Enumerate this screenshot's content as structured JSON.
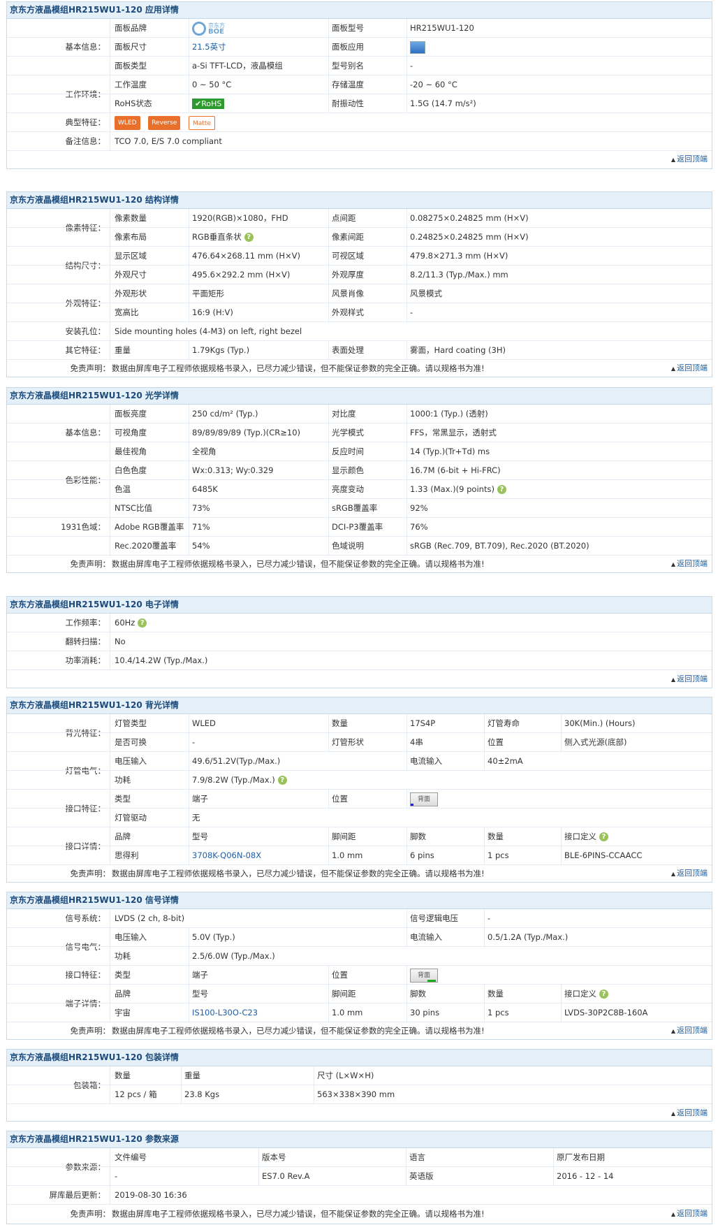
{
  "s1": {
    "title": "京东方液晶模组HR215WU1-120 应用详情",
    "g_basic": "基本信息：",
    "g_env": "工作环境：",
    "g_typ": "典型特征：",
    "g_note": "备注信息：",
    "brand_l": "面板品牌",
    "brand_logo": "京东方 BOE",
    "brand_logo_cn": "京东方",
    "brand_logo_en": "BOE",
    "model_l": "面板型号",
    "model_v": "HR215WU1-120",
    "size_l": "面板尺寸",
    "size_v": "21.5英寸",
    "app_l": "面板应用",
    "app_icon": "monitor-icon",
    "type_l": "面板类型",
    "type_v": "a-Si TFT-LCD，液晶模组",
    "alias_l": "型号别名",
    "alias_v": "-",
    "optemp_l": "工作温度",
    "optemp_v": "0 ~ 50 °C",
    "sttemp_l": "存储温度",
    "sttemp_v": "-20 ~ 60 °C",
    "rohs_l": "RoHS状态",
    "rohs_v": "RoHS",
    "vib_l": "耐振动性",
    "vib_v": "1.5G (14.7 m/s²)",
    "feat1": "WLED",
    "feat2": "Reverse",
    "feat3": "Matte",
    "note_v": "TCO 7.0, E/S 7.0 compliant",
    "top": "返回顶端"
  },
  "s2": {
    "title": "京东方液晶模组HR215WU1-120 结构详情",
    "g_pix": "像素特征：",
    "g_dim": "结构尺寸：",
    "g_look": "外观特征：",
    "g_mount": "安装孔位：",
    "g_other": "其它特征：",
    "px_l": "像素数量",
    "px_v": "1920(RGB)×1080，FHD",
    "dot_l": "点间距",
    "dot_v": "0.08275×0.24825 mm (H×V)",
    "arr_l": "像素布局",
    "arr_v": "RGB垂直条状",
    "pitch_l": "像素间距",
    "pitch_v": "0.24825×0.24825 mm (H×V)",
    "aa_l": "显示区域",
    "aa_v": "476.64×268.11 mm (H×V)",
    "va_l": "可视区域",
    "va_v": "479.8×271.3 mm (H×V)",
    "od_l": "外观尺寸",
    "od_v": "495.6×292.2 mm (H×V)",
    "th_l": "外观厚度",
    "th_v": "8.2/11.3 (Typ./Max.) mm",
    "shape_l": "外观形状",
    "shape_v": "平面矩形",
    "orient_l": "风景肖像",
    "orient_v": "风景模式",
    "ratio_l": "宽高比",
    "ratio_v": "16:9 (H:V)",
    "style_l": "外观样式",
    "style_v": "-",
    "mount_v": "Side mounting holes (4-M3) on left, right bezel",
    "wt_l": "重量",
    "wt_v": "1.79Kgs (Typ.)",
    "surf_l": "表面处理",
    "surf_v": "雾面，Hard coating (3H)",
    "disc_l": "免责声明：",
    "disc_v": "数据由屏库电子工程师依据规格书录入，已尽力减少错误，但不能保证参数的完全正确。请以规格书为准!",
    "top": "返回顶端"
  },
  "s3": {
    "title": "京东方液晶模组HR215WU1-120 光学详情",
    "g_basic": "基本信息：",
    "g_color": "色彩性能：",
    "g_gamut": "1931色域：",
    "br_l": "面板亮度",
    "br_v": "250 cd/m² (Typ.)",
    "cr_l": "对比度",
    "cr_v": "1000:1 (Typ.) (透射)",
    "va_l": "可视角度",
    "va_v": "89/89/89/89 (Typ.)(CR≥10)",
    "mode_l": "光学模式",
    "mode_v": "FFS，常黑显示，透射式",
    "bv_l": "最佳视角",
    "bv_v": "全视角",
    "rt_l": "反应时间",
    "rt_v": "14 (Typ.)(Tr+Td) ms",
    "wc_l": "白色色度",
    "wc_v": "Wx:0.313; Wy:0.329",
    "col_l": "显示颜色",
    "col_v": "16.7M (6-bit + Hi-FRC)",
    "ct_l": "色温",
    "ct_v": "6485K",
    "bvar_l": "亮度变动",
    "bvar_v": "1.33 (Max.)(9 points)",
    "ntsc_l": "NTSC比值",
    "ntsc_v": "73%",
    "srgb_l": "sRGB覆盖率",
    "srgb_v": "92%",
    "adobe_l": "Adobe RGB覆盖率",
    "adobe_v": "71%",
    "p3_l": "DCI-P3覆盖率",
    "p3_v": "76%",
    "r2020_l": "Rec.2020覆盖率",
    "r2020_v": "54%",
    "gdesc_l": "色域说明",
    "gdesc_v": "sRGB (Rec.709, BT.709), Rec.2020 (BT.2020)",
    "disc_l": "免责声明：",
    "disc_v": "数据由屏库电子工程师依据规格书录入，已尽力减少错误，但不能保证参数的完全正确。请以规格书为准!",
    "top": "返回顶端"
  },
  "s4": {
    "title": "京东方液晶模组HR215WU1-120 电子详情",
    "freq_l": "工作频率：",
    "freq_v": "60Hz",
    "scan_l": "翻转扫描：",
    "scan_v": "No",
    "pow_l": "功率消耗：",
    "pow_v": "10.4/14.2W (Typ./Max.)",
    "top": "返回顶端"
  },
  "s5": {
    "title": "京东方液晶模组HR215WU1-120 背光详情",
    "g_bl": "背光特征：",
    "g_elec": "灯管电气：",
    "g_if": "接口特征：",
    "g_ifd": "接口详情：",
    "lt_l": "灯管类型",
    "lt_v": "WLED",
    "cnt_l": "数量",
    "cnt_v": "17S4P",
    "life_l": "灯管寿命",
    "life_v": "30K(Min.) (Hours)",
    "repl_l": "是否可换",
    "repl_v": "-",
    "shape_l": "灯管形状",
    "shape_v": "4串",
    "pos_l": "位置",
    "pos_v": "侧入式光源(底部)",
    "vin_l": "电压输入",
    "vin_v": "49.6/51.2V(Typ./Max.)",
    "iin_l": "电流输入",
    "iin_v": "40±2mA",
    "pw_l": "功耗",
    "pw_v": "7.9/8.2W (Typ./Max.)",
    "if_type_l": "类型",
    "if_type_v": "端子",
    "if_pos_l": "位置",
    "if_pos_v": "背面",
    "drv_l": "灯管驱动",
    "drv_v": "无",
    "h_brand": "品牌",
    "h_model": "型号",
    "h_pitch": "脚间距",
    "h_pins": "脚数",
    "h_qty": "数量",
    "h_def": "接口定义",
    "d_brand": "思得利",
    "d_model": "3708K-Q06N-08X",
    "d_pitch": "1.0 mm",
    "d_pins": "6 pins",
    "d_qty": "1 pcs",
    "d_def": "BLE-6PINS-CCAACC",
    "disc_l": "免责声明：",
    "disc_v": "数据由屏库电子工程师依据规格书录入，已尽力减少错误，但不能保证参数的完全正确。请以规格书为准!",
    "top": "返回顶端"
  },
  "s6": {
    "title": "京东方液晶模组HR215WU1-120 信号详情",
    "sys_l": "信号系统：",
    "sys_v": "LVDS (2 ch, 8-bit)",
    "lv_l": "信号逻辑电压",
    "lv_v": "-",
    "g_elec": "信号电气：",
    "vin_l": "电压输入",
    "vin_v": "5.0V (Typ.)",
    "iin_l": "电流输入",
    "iin_v": "0.5/1.2A (Typ./Max.)",
    "pw_l": "功耗",
    "pw_v": "2.5/6.0W (Typ./Max.)",
    "g_if": "接口特征：",
    "if_type_l": "类型",
    "if_type_v": "端子",
    "if_pos_l": "位置",
    "if_pos_v": "背面",
    "g_term": "端子详情：",
    "h_brand": "品牌",
    "h_model": "型号",
    "h_pitch": "脚间距",
    "h_pins": "脚数",
    "h_qty": "数量",
    "h_def": "接口定义",
    "d_brand": "宇宙",
    "d_model": "IS100-L30O-C23",
    "d_pitch": "1.0 mm",
    "d_pins": "30 pins",
    "d_qty": "1 pcs",
    "d_def": "LVDS-30P2C8B-160A",
    "disc_l": "免责声明：",
    "disc_v": "数据由屏库电子工程师依据规格书录入，已尽力减少错误，但不能保证参数的完全正确。请以规格书为准!",
    "top": "返回顶端"
  },
  "s7": {
    "title": "京东方液晶模组HR215WU1-120 包装详情",
    "g_box": "包装箱：",
    "h_qty": "数量",
    "h_wt": "重量",
    "h_size": "尺寸 (L×W×H)",
    "d_qty": "12 pcs / 箱",
    "d_wt": "23.8 Kgs",
    "d_size": "563×338×390 mm",
    "top": "返回顶端"
  },
  "s8": {
    "title": "京东方液晶模组HR215WU1-120 参数来源",
    "g_src": "参数来源：",
    "h_doc": "文件编号",
    "h_ver": "版本号",
    "h_lang": "语言",
    "h_date": "原厂发布日期",
    "d_doc": "-",
    "d_ver": "ES7.0 Rev.A",
    "d_lang": "英语版",
    "d_date": "2016 - 12 - 14",
    "upd_l": "屏库最后更新：",
    "upd_v": "2019-08-30 16:36",
    "disc_l": "免责声明：",
    "disc_v": "数据由屏库电子工程师依据规格书录入，已尽力减少错误，但不能保证参数的完全正确。请以规格书为准!",
    "top": "返回顶端"
  }
}
